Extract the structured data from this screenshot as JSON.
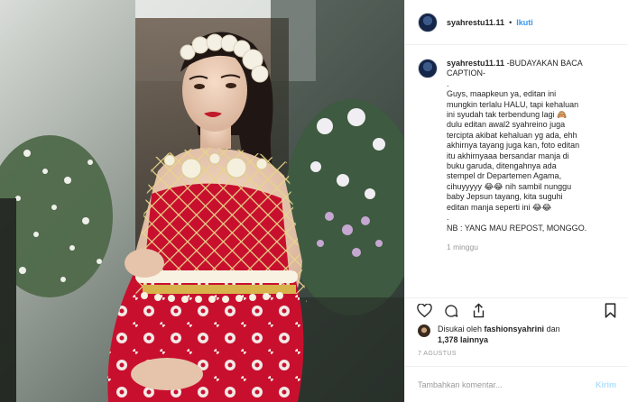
{
  "post": {
    "username": "syahrestu11.11",
    "dot": "•",
    "follow_label": "Ikuti"
  },
  "caption": {
    "username": "syahrestu11.11",
    "lines": [
      "-BUDAYAKAN BACA",
      "CAPTION-",
      ".",
      "Guys, maapkeun ya, editan ini",
      "mungkin terlalu HALU, tapi kehaluan",
      "ini syudah tak terbendung lagi 🙈",
      "dulu editan awal2 syahreino juga",
      "tercipta akibat kehaluan yg ada, ehh",
      "akhirnya tayang juga kan, foto editan",
      "itu akhirnyaaa bersandar manja di",
      "buku garuda, ditengahnya ada",
      "stempel dr Departemen Agama,",
      "cihuyyyyy 😂😂 nih sambil nunggu",
      "baby Jepsun tayang, kita suguhi",
      "editan manja seperti ini 😂😂",
      ".",
      "NB : YANG MAU REPOST, MONGGO."
    ],
    "time": "1 minggu"
  },
  "likes": {
    "prefix": "Disukai oleh",
    "user": "fashionsyahrini",
    "and": "dan",
    "count": "1,378 lainnya"
  },
  "date": "7 AGUSTUS",
  "comment": {
    "placeholder": "Tambahkan komentar...",
    "post_label": "Kirim"
  },
  "icons": {
    "like": "heart-icon",
    "comment": "comment-icon",
    "share": "share-icon",
    "save": "bookmark-icon"
  },
  "colors": {
    "link_blue": "#3897f0",
    "post_disabled": "#b2dffc",
    "dress_red": "#c8102e"
  }
}
